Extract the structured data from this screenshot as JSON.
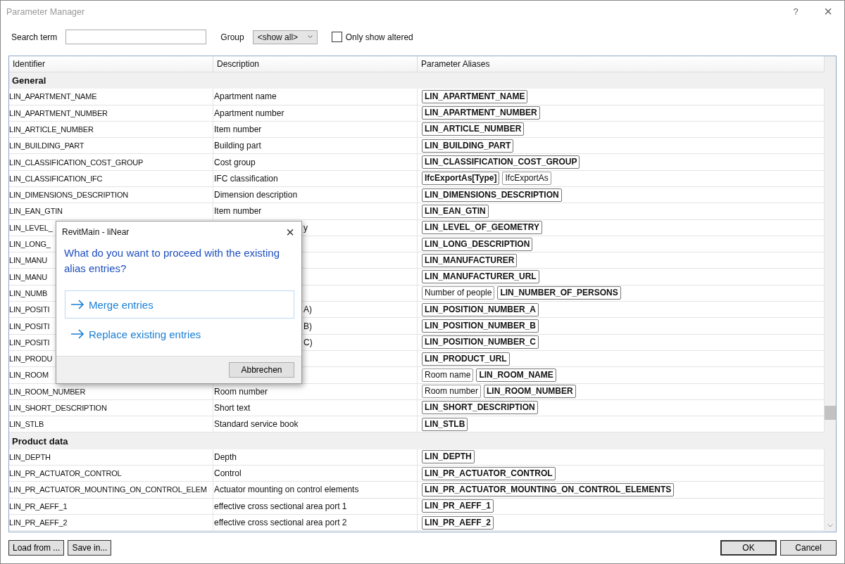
{
  "window": {
    "title": "Parameter Manager",
    "help": "?",
    "close": "×"
  },
  "toolbar": {
    "search_label": "Search term",
    "group_label": "Group",
    "group_value": "<show all>",
    "only_altered": {
      "label": "Only show altered",
      "checked": false
    }
  },
  "table": {
    "columns": [
      "Identifier",
      "Description",
      "Parameter Aliases"
    ],
    "groups": [
      {
        "name": "General",
        "rows": [
          {
            "identifier": "LIN_APARTMENT_NAME",
            "description": "Apartment name",
            "aliases": [
              {
                "text": "LIN_APARTMENT_NAME",
                "kind": "parameter"
              }
            ]
          },
          {
            "identifier": "LIN_APARTMENT_NUMBER",
            "description": "Apartment number",
            "aliases": [
              {
                "text": "LIN_APARTMENT_NUMBER",
                "kind": "parameter"
              }
            ]
          },
          {
            "identifier": "LIN_ARTICLE_NUMBER",
            "description": "Item number",
            "aliases": [
              {
                "text": "LIN_ARTICLE_NUMBER",
                "kind": "parameter"
              }
            ]
          },
          {
            "identifier": "LIN_BUILDING_PART",
            "description": "Building part",
            "aliases": [
              {
                "text": "LIN_BUILDING_PART",
                "kind": "parameter"
              }
            ]
          },
          {
            "identifier": "LIN_CLASSIFICATION_COST_GROUP",
            "description": "Cost group",
            "aliases": [
              {
                "text": "LIN_CLASSIFICATION_COST_GROUP",
                "kind": "parameter"
              }
            ]
          },
          {
            "identifier": "LIN_CLASSIFICATION_IFC",
            "description": "IFC classification",
            "aliases": [
              {
                "text": "IfcExportAs[Type]",
                "kind": "parameter"
              },
              {
                "text": "IfcExportAs",
                "kind": "text"
              }
            ]
          },
          {
            "identifier": "LIN_DIMENSIONS_DESCRIPTION",
            "description": "Dimension description",
            "aliases": [
              {
                "text": "LIN_DIMENSIONS_DESCRIPTION",
                "kind": "parameter"
              }
            ]
          },
          {
            "identifier": "LIN_EAN_GTIN",
            "description": "Item number",
            "aliases": [
              {
                "text": "LIN_EAN_GTIN",
                "kind": "parameter"
              }
            ]
          },
          {
            "identifier": "LIN_LEVEL_",
            "description": "y",
            "obscured": true,
            "aliases": [
              {
                "text": "LIN_LEVEL_OF_GEOMETRY",
                "kind": "parameter"
              }
            ]
          },
          {
            "identifier": "LIN_LONG_",
            "aliases": [
              {
                "text": "LIN_LONG_DESCRIPTION",
                "kind": "parameter"
              }
            ]
          },
          {
            "identifier": "LIN_MANU",
            "aliases": [
              {
                "text": "LIN_MANUFACTURER",
                "kind": "parameter"
              }
            ]
          },
          {
            "identifier": "LIN_MANU",
            "aliases": [
              {
                "text": "LIN_MANUFACTURER_URL",
                "kind": "parameter"
              }
            ]
          },
          {
            "identifier": "LIN_NUMB",
            "aliases": [
              {
                "text": "Number of people",
                "kind": "text"
              },
              {
                "text": "LIN_NUMBER_OF_PERSONS",
                "kind": "parameter"
              }
            ]
          },
          {
            "identifier": "LIN_POSITI",
            "description": "A)",
            "obscured": true,
            "aliases": [
              {
                "text": "LIN_POSITION_NUMBER_A",
                "kind": "parameter"
              }
            ]
          },
          {
            "identifier": "LIN_POSITI",
            "description": "B)",
            "obscured": true,
            "aliases": [
              {
                "text": "LIN_POSITION_NUMBER_B",
                "kind": "parameter"
              }
            ]
          },
          {
            "identifier": "LIN_POSITI",
            "description": "C)",
            "obscured": true,
            "aliases": [
              {
                "text": "LIN_POSITION_NUMBER_C",
                "kind": "parameter"
              }
            ]
          },
          {
            "identifier": "LIN_PRODU",
            "aliases": [
              {
                "text": "LIN_PRODUCT_URL",
                "kind": "parameter"
              }
            ]
          },
          {
            "identifier": "LIN_ROOM",
            "aliases": [
              {
                "text": "Room name",
                "kind": "text"
              },
              {
                "text": "LIN_ROOM_NAME",
                "kind": "parameter"
              }
            ]
          },
          {
            "identifier": "LIN_ROOM_NUMBER",
            "description": "Room number",
            "aliases": [
              {
                "text": "Room number",
                "kind": "text"
              },
              {
                "text": "LIN_ROOM_NUMBER",
                "kind": "parameter"
              }
            ]
          },
          {
            "identifier": "LIN_SHORT_DESCRIPTION",
            "description": "Short text",
            "aliases": [
              {
                "text": "LIN_SHORT_DESCRIPTION",
                "kind": "parameter"
              }
            ]
          },
          {
            "identifier": "LIN_STLB",
            "description": "Standard service book",
            "aliases": [
              {
                "text": "LIN_STLB",
                "kind": "parameter"
              }
            ]
          }
        ]
      },
      {
        "name": "Product data",
        "rows": [
          {
            "identifier": "LIN_DEPTH",
            "description": "Depth",
            "aliases": [
              {
                "text": "LIN_DEPTH",
                "kind": "parameter"
              }
            ]
          },
          {
            "identifier": "LIN_PR_ACTUATOR_CONTROL",
            "description": "Control",
            "aliases": [
              {
                "text": "LIN_PR_ACTUATOR_CONTROL",
                "kind": "parameter"
              }
            ]
          },
          {
            "identifier": "LIN_PR_ACTUATOR_MOUNTING_ON_CONTROL_ELEM",
            "description": "Actuator mounting on control elements",
            "aliases": [
              {
                "text": "LIN_PR_ACTUATOR_MOUNTING_ON_CONTROL_ELEMENTS",
                "kind": "parameter"
              }
            ]
          },
          {
            "identifier": "LIN_PR_AEFF_1",
            "description": "effective cross sectional area port 1",
            "aliases": [
              {
                "text": "LIN_PR_AEFF_1",
                "kind": "parameter"
              }
            ]
          },
          {
            "identifier": "LIN_PR_AEFF_2",
            "description": "effective cross sectional area port 2",
            "aliases": [
              {
                "text": "LIN_PR_AEFF_2",
                "kind": "parameter"
              }
            ]
          }
        ]
      }
    ]
  },
  "footer": {
    "left_buttons": [
      "Load from ...",
      "Save in..."
    ],
    "right_buttons": [
      {
        "label": "OK",
        "default": true
      },
      {
        "label": "Cancel",
        "default": false
      }
    ]
  },
  "dialog": {
    "title": "RevitMain - liNear",
    "close": "×",
    "question": "What do you want to proceed with the existing alias entries?",
    "options": [
      {
        "label": "Merge entries",
        "selected": true
      },
      {
        "label": "Replace existing entries",
        "selected": false
      }
    ],
    "cancel": "Abbrechen"
  }
}
